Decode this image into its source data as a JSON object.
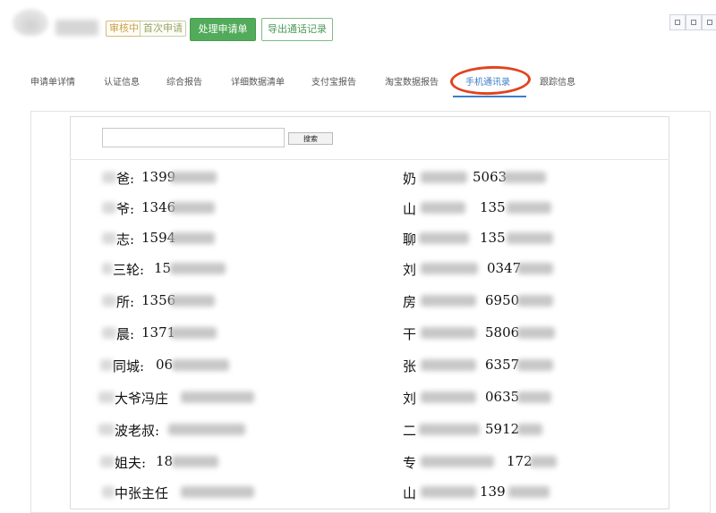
{
  "header": {
    "app_name": "",
    "badges": [
      "审核中",
      "首次申请"
    ],
    "process_button": "处理申请单",
    "export_button": "导出通话记录"
  },
  "tabs": [
    {
      "label": "申请单详情",
      "active": false
    },
    {
      "label": "认证信息",
      "active": false
    },
    {
      "label": "综合报告",
      "active": false
    },
    {
      "label": "详细数据清单",
      "active": false
    },
    {
      "label": "支付宝报告",
      "active": false
    },
    {
      "label": "淘宝数据报告",
      "active": false
    },
    {
      "label": "手机通讯录",
      "active": true
    },
    {
      "label": "跟踪信息",
      "active": false
    }
  ],
  "search": {
    "placeholder": "",
    "button_label": "搜索"
  },
  "contacts_left": [
    {
      "name": "爸:",
      "number": "1399"
    },
    {
      "name": "爷:",
      "number": "1346"
    },
    {
      "name": "志:",
      "number": "1594"
    },
    {
      "name": "三轮:",
      "number": "15"
    },
    {
      "name": "所:",
      "number": "1356"
    },
    {
      "name": "晨:",
      "number": "1371"
    },
    {
      "name": "同城:",
      "number": "06"
    },
    {
      "name": "大爷冯庄",
      "number": ""
    },
    {
      "name": "波老叔:",
      "number": ""
    },
    {
      "name": "姐夫:",
      "number": "18"
    },
    {
      "name": "中张主任",
      "number": ""
    }
  ],
  "contacts_right": [
    {
      "name": "奶",
      "number": "5063"
    },
    {
      "name": "山",
      "number": "135"
    },
    {
      "name": "聊",
      "number": "135"
    },
    {
      "name": "刘",
      "number": "0347"
    },
    {
      "name": "房",
      "number": "6950"
    },
    {
      "name": "干",
      "number": "5806"
    },
    {
      "name": "张",
      "number": "6357"
    },
    {
      "name": "刘",
      "number": "0635"
    },
    {
      "name": "二",
      "number": "5912"
    },
    {
      "name": "专",
      "number": "172"
    },
    {
      "name": "山",
      "number": "139"
    }
  ],
  "colors": {
    "accent_blue": "#3b7ec8",
    "green_button": "#52ab5a",
    "annotation_red": "#e2431f"
  }
}
